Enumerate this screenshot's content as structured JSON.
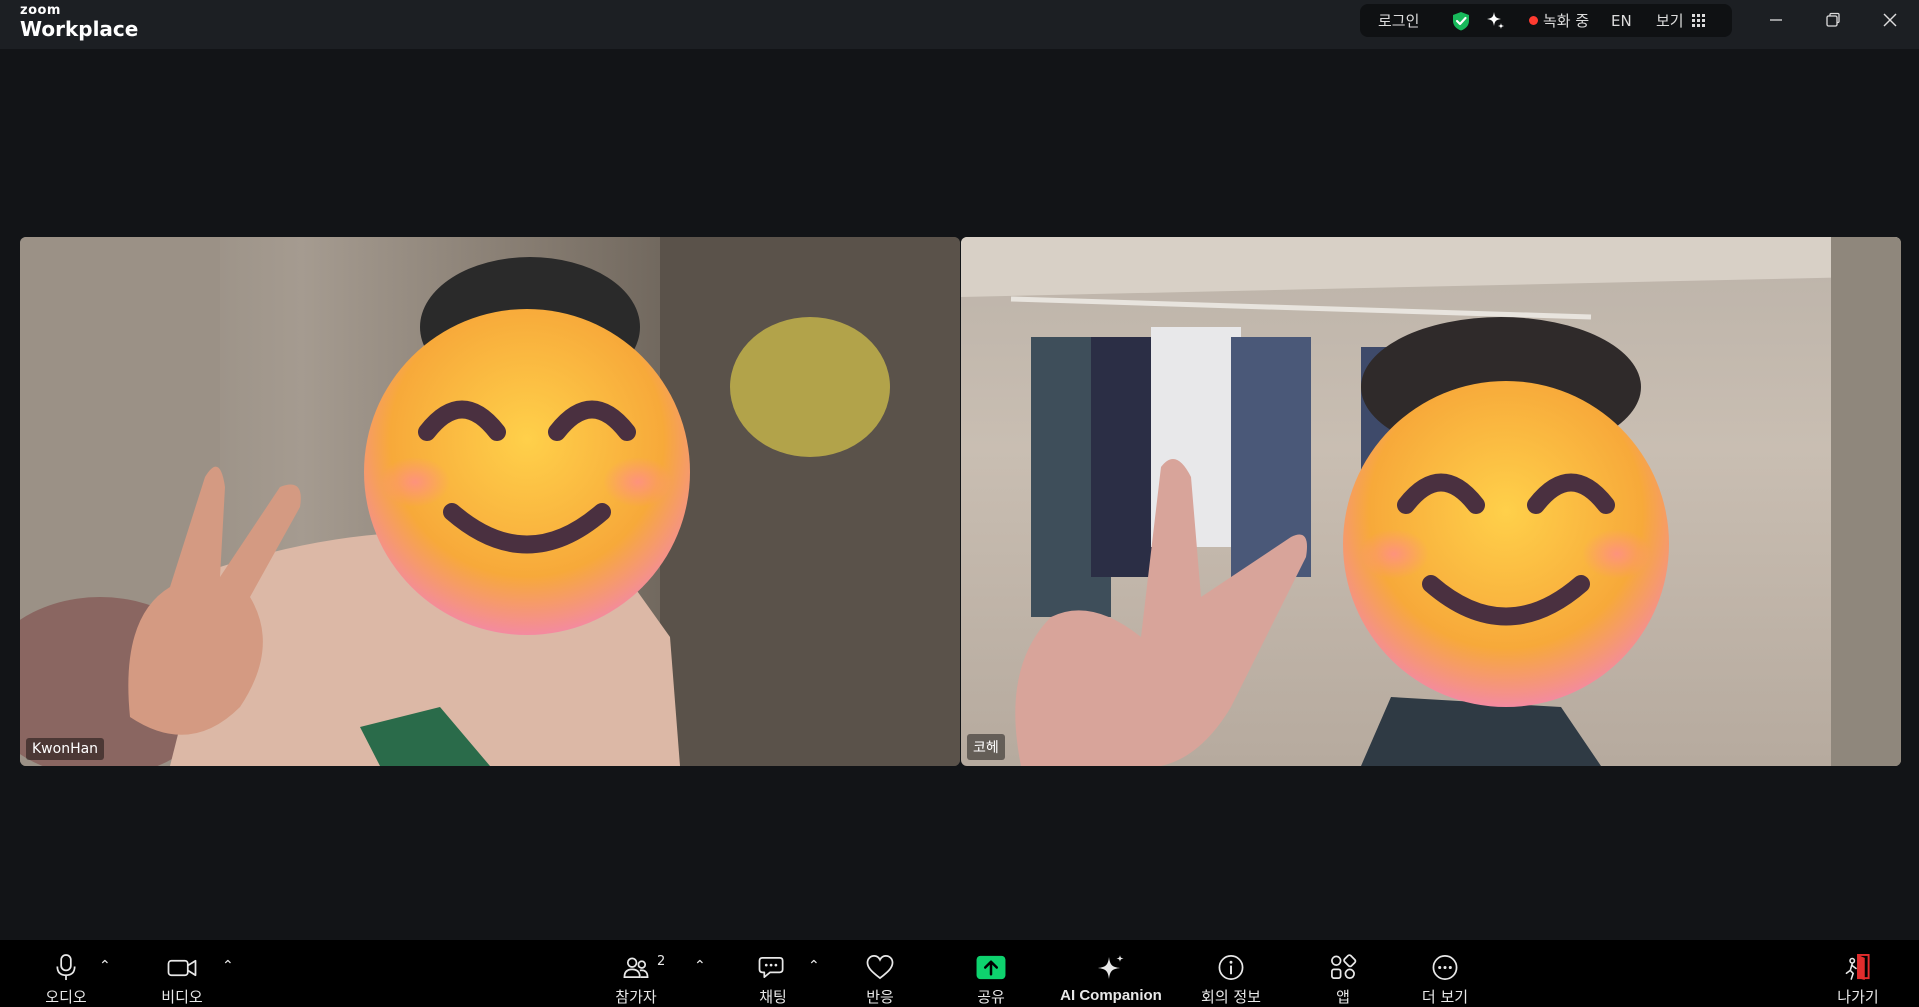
{
  "app": {
    "logo_top": "zoom",
    "logo_bottom": "Workplace"
  },
  "status_pill": {
    "login": "로그인",
    "recording": "녹화 중",
    "language": "EN",
    "view": "보기"
  },
  "participants_tiles": [
    {
      "name": "KwonHan"
    },
    {
      "name": "코헤"
    }
  ],
  "toolbar": {
    "audio": "오디오",
    "video": "비디오",
    "participants": "참가자",
    "participants_count": "2",
    "chat": "채팅",
    "reactions": "반응",
    "share": "공유",
    "ai_companion": "AI Companion",
    "meeting_info": "회의 정보",
    "apps": "앱",
    "more": "더 보기",
    "leave": "나가기"
  },
  "colors": {
    "share_green": "#0ed26e",
    "record_red": "#ff3b30",
    "shield_green": "#18b95b",
    "leave_red": "#e22d2d"
  }
}
